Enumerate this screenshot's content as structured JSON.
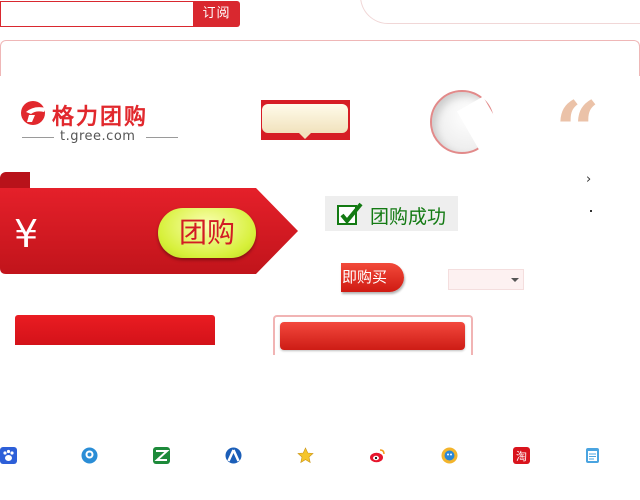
{
  "subscribe": {
    "input_value": "",
    "button_label": "订阅"
  },
  "logo": {
    "name": "格力团购",
    "url": "t.gree.com"
  },
  "quote_mark": "“",
  "promo": {
    "currency_symbol": "¥",
    "group_buy_label": "团购"
  },
  "status": {
    "success_text": "团购成功"
  },
  "actions": {
    "buy_now_label": "即购买"
  },
  "nav_arrow": "›",
  "colors": {
    "brand_red": "#d9282f",
    "success_green": "#137a13",
    "lime": "#d7f03a"
  },
  "share_icons": [
    "baidu-icon",
    "qzone-icon",
    "renren-icon",
    "kaixin-icon",
    "favorite-star-icon",
    "weibo-icon",
    "qq-icon",
    "taobao-icon",
    "notepad-icon"
  ]
}
